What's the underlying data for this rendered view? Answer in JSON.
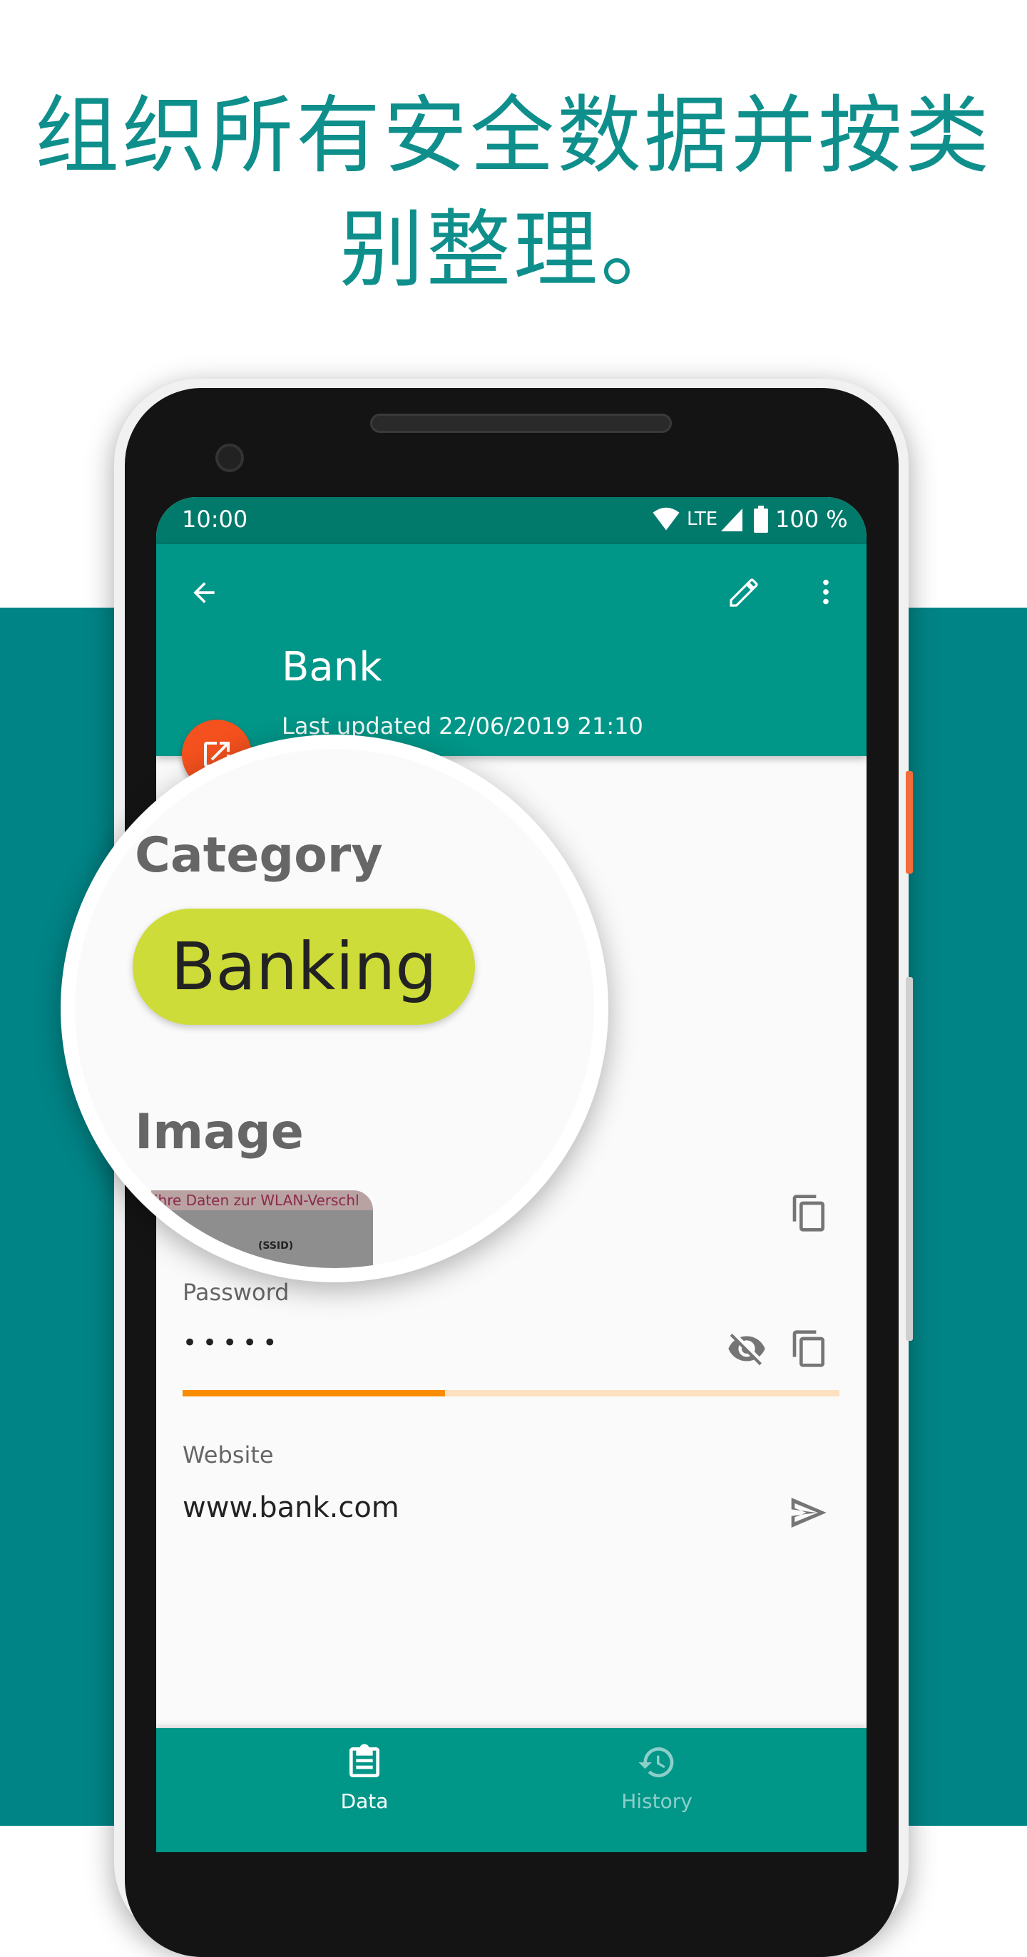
{
  "headline": {
    "line1": "组织所有安全数据并按类",
    "line2": "别整理。"
  },
  "colors": {
    "teal_background": "#008486",
    "app_bar": "#009688",
    "status_bar": "#017a6c",
    "fab": "#f4511e",
    "chip": "#cddc39",
    "strength_fill": "#fb8c00",
    "strength_track": "#fde0c0"
  },
  "status_bar": {
    "time": "10:00",
    "network": "LTE",
    "battery": "100 %"
  },
  "app_bar": {
    "title": "Bank",
    "subtitle": "Last updated 22/06/2019 21:10",
    "icons": [
      "arrow-back-icon",
      "edit-icon",
      "more-vert-icon"
    ]
  },
  "magnifier": {
    "category_label": "Category",
    "category_value": "Banking",
    "image_label": "Image",
    "image_caption": "ihre Daten zur WLAN-Verschl",
    "image_text2": "(SSID)"
  },
  "fields": {
    "password": {
      "label": "Password",
      "value": "•••••",
      "strength_fraction": 0.4
    },
    "website": {
      "label": "Website",
      "value": "www.bank.com"
    }
  },
  "bottom_nav": [
    {
      "label": "Data",
      "icon": "clipboard-icon",
      "active": true
    },
    {
      "label": "History",
      "icon": "history-icon",
      "active": false
    }
  ]
}
